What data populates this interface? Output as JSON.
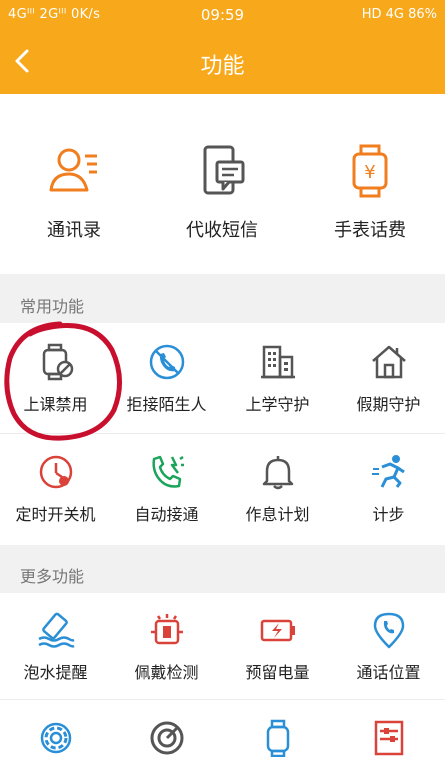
{
  "status_bar": {
    "left": "4Gᴵᴵᴵ  2Gᴵᴵᴵ  0K/s",
    "time": "09:59",
    "right": "HD 4G 86%"
  },
  "header": {
    "title": "功能",
    "back_icon": "chevron-left-icon"
  },
  "top_features": [
    {
      "label": "通讯录",
      "icon": "contacts-icon"
    },
    {
      "label": "代收短信",
      "icon": "sms-icon"
    },
    {
      "label": "手表话费",
      "icon": "watch-fee-icon"
    }
  ],
  "common_section": {
    "title": "常用功能",
    "items": [
      {
        "label": "上课禁用",
        "icon": "class-disable-icon"
      },
      {
        "label": "拒接陌生人",
        "icon": "reject-stranger-icon"
      },
      {
        "label": "上学守护",
        "icon": "school-guard-icon"
      },
      {
        "label": "假期守护",
        "icon": "holiday-guard-icon"
      },
      {
        "label": "定时开关机",
        "icon": "timer-power-icon"
      },
      {
        "label": "自动接通",
        "icon": "auto-answer-icon"
      },
      {
        "label": "作息计划",
        "icon": "schedule-bell-icon"
      },
      {
        "label": "计步",
        "icon": "pedometer-icon"
      }
    ]
  },
  "more_section": {
    "title": "更多功能",
    "items": [
      {
        "label": "泡水提醒",
        "icon": "water-alert-icon"
      },
      {
        "label": "佩戴检测",
        "icon": "wear-detect-icon"
      },
      {
        "label": "预留电量",
        "icon": "battery-reserve-icon"
      },
      {
        "label": "通话位置",
        "icon": "call-location-icon"
      }
    ],
    "partial_icons": [
      "settings-icon",
      "radar-icon",
      "watch-icon",
      "equalizer-icon"
    ]
  },
  "colors": {
    "header": "#f7a81b",
    "orange_icon": "#f07d1e",
    "blue_icon": "#2a8fd6",
    "gray_icon": "#555555",
    "red_icon": "#d9433a",
    "green_icon": "#1aa55a",
    "annotation": "#c8102e"
  }
}
